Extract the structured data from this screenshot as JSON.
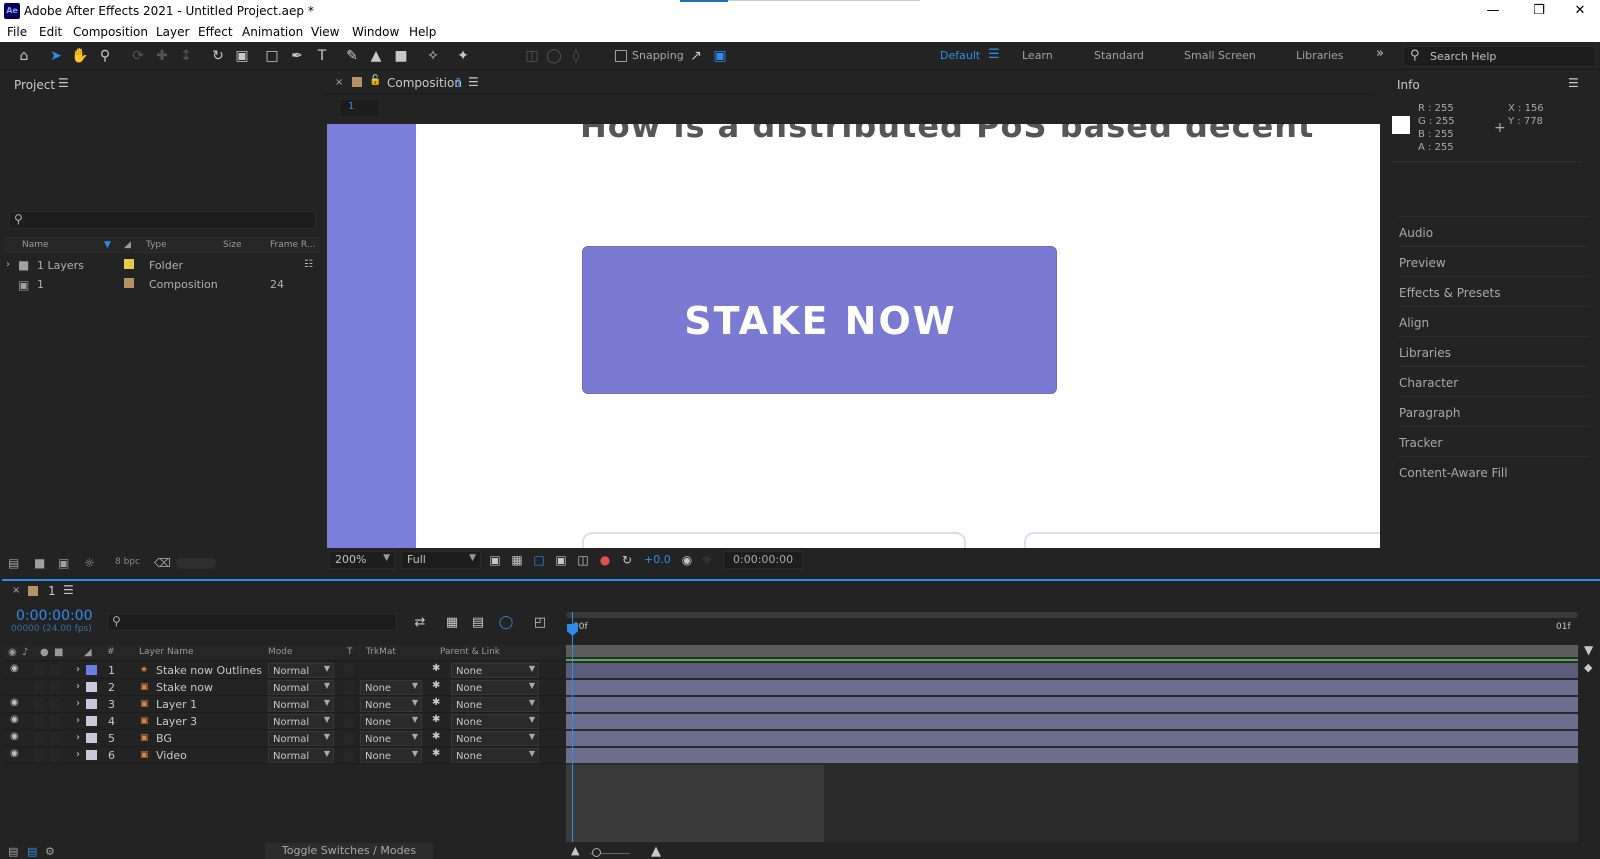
{
  "window": {
    "title": "Adobe After Effects 2021 - Untitled Project.aep *",
    "app_icon": "Ae"
  },
  "menu": [
    "File",
    "Edit",
    "Composition",
    "Layer",
    "Effect",
    "Animation",
    "View",
    "Window",
    "Help"
  ],
  "toolbar": {
    "snapping_label": "Snapping",
    "workspaces": [
      "Default",
      "Learn",
      "Standard",
      "Small Screen",
      "Libraries"
    ],
    "active_workspace": "Default",
    "search_help": "Search Help",
    "overflow": "»"
  },
  "project": {
    "title": "Project",
    "columns": [
      "Name",
      "Type",
      "Size",
      "Frame R..."
    ],
    "items": [
      {
        "name": "1 Layers",
        "type": "Folder",
        "size": "",
        "frame_rate": "",
        "color": "#e8c84a"
      },
      {
        "name": "1",
        "type": "Composition",
        "size": "",
        "frame_rate": "24",
        "color": "#b59266"
      }
    ],
    "bpc": "8 bpc"
  },
  "composition": {
    "tab_label": "Composition",
    "tab_number": "1",
    "sub_tab": "1",
    "button_text": "STAKE NOW",
    "button_color": "#7a7ad2",
    "sidebar_color": "#7a7ed8",
    "zoom": "200%",
    "resolution": "Full",
    "exposure": "+0.0",
    "timecode": "0:00:00:00"
  },
  "info": {
    "title": "Info",
    "r": "R : 255",
    "g": "G : 255",
    "b": "B : 255",
    "a": "A : 255",
    "x": "X : 156",
    "y": "Y : 778"
  },
  "right_panels": [
    "Audio",
    "Preview",
    "Effects & Presets",
    "Align",
    "Libraries",
    "Character",
    "Paragraph",
    "Tracker",
    "Content-Aware Fill"
  ],
  "timeline": {
    "tab_label": "1",
    "timecode": "0:00:00:00",
    "fps": "00000 (24.00 fps)",
    "columns": {
      "num": "#",
      "layer_name": "Layer Name",
      "mode": "Mode",
      "t": "T",
      "trkmat": "TrkMat",
      "parent": "Parent & Link"
    },
    "ruler_start": "00f",
    "ruler_end": "01f",
    "layers": [
      {
        "num": "1",
        "name": "Stake now Outlines",
        "mode": "Normal",
        "trkmat": "",
        "parent": "None",
        "visible": true,
        "color": "#6a7fe8"
      },
      {
        "num": "2",
        "name": "Stake now",
        "mode": "Normal",
        "trkmat": "None",
        "parent": "None",
        "visible": false,
        "color": "#c8c8d8"
      },
      {
        "num": "3",
        "name": "Layer 1",
        "mode": "Normal",
        "trkmat": "None",
        "parent": "None",
        "visible": true,
        "color": "#c8c8d8"
      },
      {
        "num": "4",
        "name": "Layer 3",
        "mode": "Normal",
        "trkmat": "None",
        "parent": "None",
        "visible": true,
        "color": "#c8c8d8"
      },
      {
        "num": "5",
        "name": "BG",
        "mode": "Normal",
        "trkmat": "None",
        "parent": "None",
        "visible": true,
        "color": "#c8c8d8"
      },
      {
        "num": "6",
        "name": "Video",
        "mode": "Normal",
        "trkmat": "None",
        "parent": "None",
        "visible": true,
        "color": "#c8c8d8"
      }
    ],
    "toggle_label": "Toggle Switches / Modes"
  }
}
